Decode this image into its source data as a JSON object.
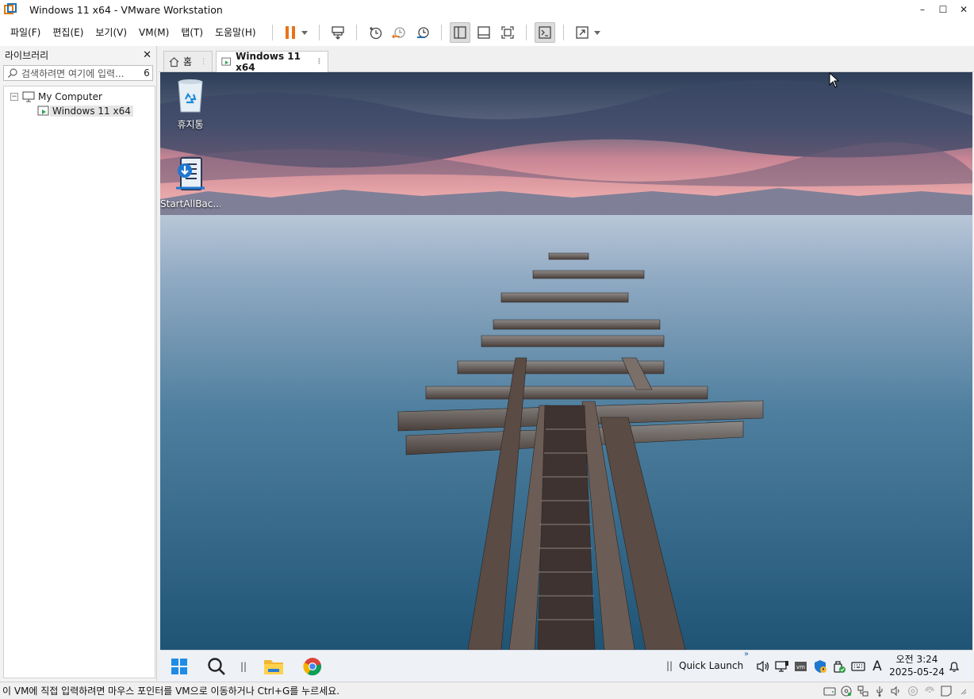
{
  "window": {
    "title": "Windows 11 x64 - VMware Workstation",
    "min": "–",
    "max": "☐",
    "close": "✕"
  },
  "menu": [
    "파일(F)",
    "편집(E)",
    "보기(V)",
    "VM(M)",
    "탭(T)",
    "도움말(H)"
  ],
  "library": {
    "title": "라이브러리",
    "close": "✕",
    "search_placeholder": "검색하려면 여기에 입력...",
    "search_count": "6",
    "root": "My Computer",
    "root_toggle": "−",
    "vm": "Windows 11 x64"
  },
  "tabs": {
    "home": "홈",
    "vm": "Windows 11 x64"
  },
  "guest": {
    "icons": {
      "recycle": "휴지통",
      "startallback": "StartAllBac..."
    },
    "taskbar": {
      "quick_launch": "Quick Launch",
      "ql_arrow": "»",
      "divider": "||",
      "time": "오전 3:24",
      "date": "2025-05-24",
      "ime": "A"
    }
  },
  "status": {
    "text": "이 VM에 직접 입력하려면 마우스 포인터를 VM으로 이동하거나 Ctrl+G를 누르세요."
  },
  "colors": {
    "accent_orange": "#e8731a",
    "vmware_blue": "#1f6fb8",
    "sea": "#3d6f8e",
    "sky_pink": "#e9a2a8"
  }
}
